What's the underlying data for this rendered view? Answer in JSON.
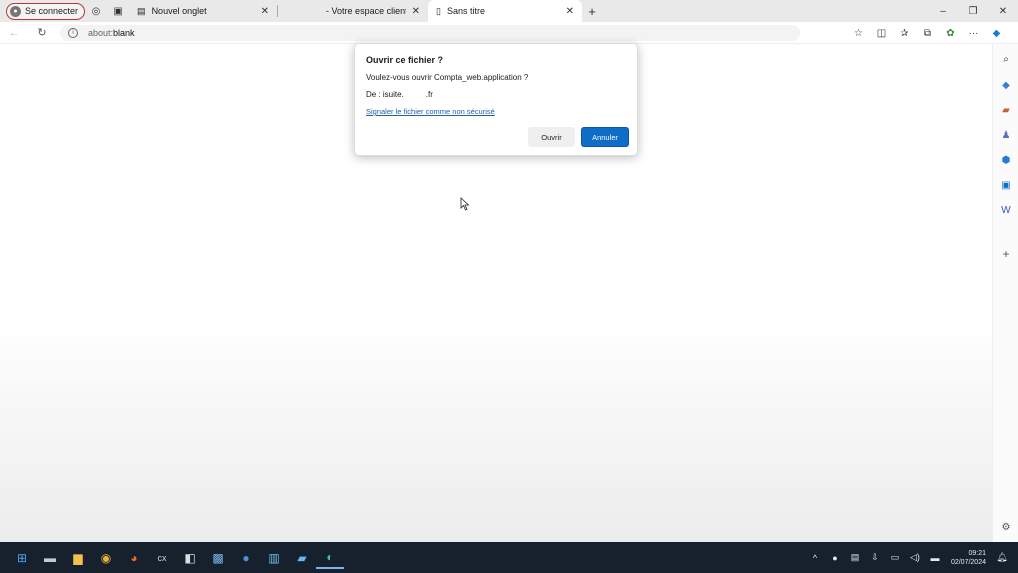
{
  "browser": {
    "profile_label": "Se connecter",
    "tabs": [
      {
        "title": "Nouvel onglet"
      },
      {
        "title": "- Votre espace client"
      },
      {
        "title": "Sans titre"
      }
    ],
    "address": {
      "host": "about:",
      "path": "blank"
    },
    "window_controls": {
      "min": "–",
      "restore": "❐",
      "close": "✕"
    }
  },
  "dialog": {
    "title": "Ouvrir ce fichier ?",
    "question": "Voulez-vous ouvrir Compta_web.application ?",
    "from_prefix": "De : isuite.",
    "from_suffix": ".fr",
    "report_link": "Signaler le fichier comme non sécurisé",
    "open_label": "Ouvrir",
    "cancel_label": "Annuler"
  },
  "taskbar": {
    "time": "09:21",
    "date": "02/07/2024"
  },
  "colors": {
    "accent": "#0f6cc7",
    "taskbar": "#17212e",
    "link": "#2060a8"
  }
}
